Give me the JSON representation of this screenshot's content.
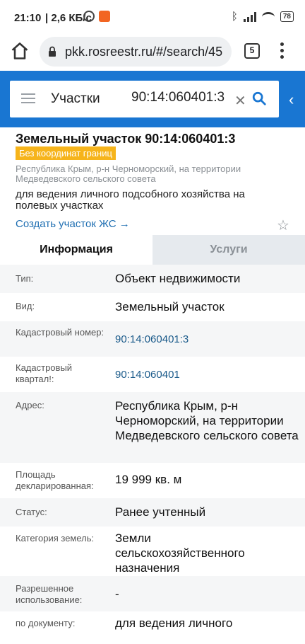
{
  "status_bar": {
    "time": "21:10",
    "speed": "| 2,6 КБ/с",
    "battery": "78"
  },
  "browser": {
    "url": "pkk.rosreestr.ru/#/search/45",
    "tab_count": "5"
  },
  "search": {
    "type_label": "Участки",
    "query": "90:14:060401:3"
  },
  "object": {
    "title": "Земельный участок 90:14:060401:3",
    "badge": "Без координат границ",
    "address": "Республика Крым, р-н Черноморский, на территории Медведевского сельского совета",
    "purpose": "для ведения личного подсобного хозяйства на полевых участках",
    "create_link": "Создать участок ЖС →"
  },
  "tabs": {
    "info": "Информация",
    "services": "Услуги"
  },
  "details": [
    {
      "label": "Тип:",
      "value": "Объект недвижимости"
    },
    {
      "label": "Вид:",
      "value": "Земельный участок"
    },
    {
      "label": "Кадастровый номер:",
      "value": "90:14:060401:3"
    },
    {
      "label": "Кадастровый квартал!:",
      "value": "90:14:060401"
    },
    {
      "label": "Адрес:",
      "value": "Республика Крым, р-н Черноморский, на территории Медведевского сельского совета"
    },
    {
      "label": "Площадь декларированная:",
      "value": "19 999 кв. м"
    },
    {
      "label": "Статус:",
      "value": "Ранее учтенный"
    },
    {
      "label": "Категория земель:",
      "value": "Земли сельскохозяйственного назначения"
    },
    {
      "label": "Разрешенное использование:",
      "value": "-"
    },
    {
      "label": "по документу:",
      "value": "для ведения личного"
    }
  ],
  "colors": {
    "header_blue": "#1976d2",
    "badge_yellow": "#f6b41b",
    "link_blue": "#1f6fb2"
  }
}
